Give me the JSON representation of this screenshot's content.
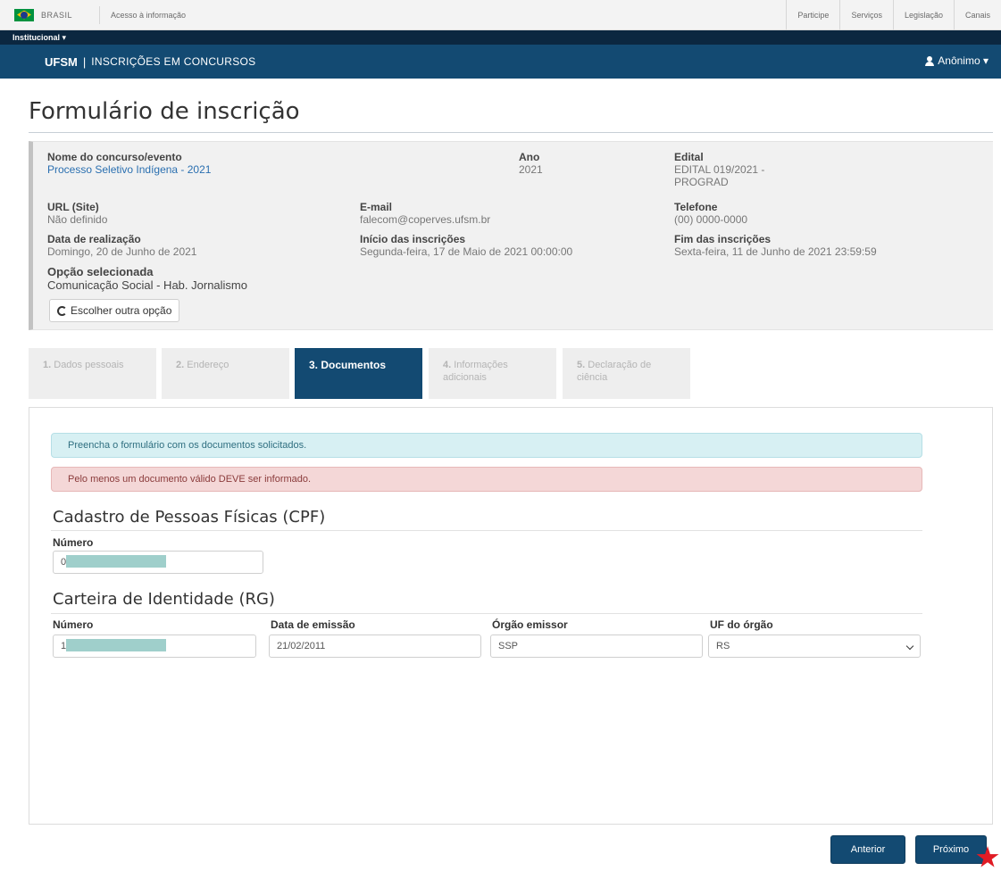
{
  "govbar": {
    "brasil": "BRASIL",
    "acesso": "Acesso à informação",
    "links": [
      "Participe",
      "Serviços",
      "Legislação",
      "Canais"
    ]
  },
  "instbar": {
    "label": "Institucional ▾"
  },
  "navbar": {
    "brand": "UFSM",
    "separator": "|",
    "subtitle": "INSCRIÇÕES EM CONCURSOS",
    "user": "Anônimo ▾"
  },
  "page": {
    "title": "Formulário de inscrição"
  },
  "info": {
    "nome_label": "Nome do concurso/evento",
    "nome_value": "Processo Seletivo Indígena - 2021",
    "ano_label": "Ano",
    "ano_value": "2021",
    "edital_label": "Edital",
    "edital_value_1": "EDITAL 019/2021 -",
    "edital_value_2": "PROGRAD",
    "url_label": "URL (Site)",
    "url_value": "Não definido",
    "email_label": "E-mail",
    "email_value": "falecom@coperves.ufsm.br",
    "telefone_label": "Telefone",
    "telefone_value": "(00) 0000-0000",
    "data_label": "Data de realização",
    "data_value": "Domingo, 20 de Junho de 2021",
    "inicio_label": "Início das inscrições",
    "inicio_value": "Segunda-feira, 17 de Maio de 2021 00:00:00",
    "fim_label": "Fim das inscrições",
    "fim_value": "Sexta-feira, 11 de Junho de 2021 23:59:59",
    "opcao_label": "Opção selecionada",
    "opcao_value": "Comunicação Social - Hab. Jornalismo",
    "alt_button": "Escolher outra opção"
  },
  "tabs": [
    {
      "num": "1.",
      "label": "Dados pessoais"
    },
    {
      "num": "2.",
      "label": "Endereço"
    },
    {
      "num": "3.",
      "label": "Documentos"
    },
    {
      "num": "4.",
      "label": "Informações adicionais"
    },
    {
      "num": "5.",
      "label": "Declaração de ciência"
    }
  ],
  "alerts": {
    "info": "Preencha o formulário com os documentos solicitados.",
    "danger": "Pelo menos um documento válido DEVE ser informado."
  },
  "cpf": {
    "title": "Cadastro de Pessoas Físicas (CPF)",
    "numero_label": "Número",
    "numero_value": "0"
  },
  "rg": {
    "title": "Carteira de Identidade (RG)",
    "numero_label": "Número",
    "numero_value": "1",
    "data_label": "Data de emissão",
    "data_value": "21/02/2011",
    "orgao_label": "Órgão emissor",
    "orgao_value": "SSP",
    "uf_label": "UF do órgão",
    "uf_value": "RS"
  },
  "buttons": {
    "anterior": "Anterior",
    "proximo": "Próximo"
  },
  "colors": {
    "navbar": "#134a72",
    "instbar": "#0b2740",
    "active_tab": "#134a72"
  }
}
